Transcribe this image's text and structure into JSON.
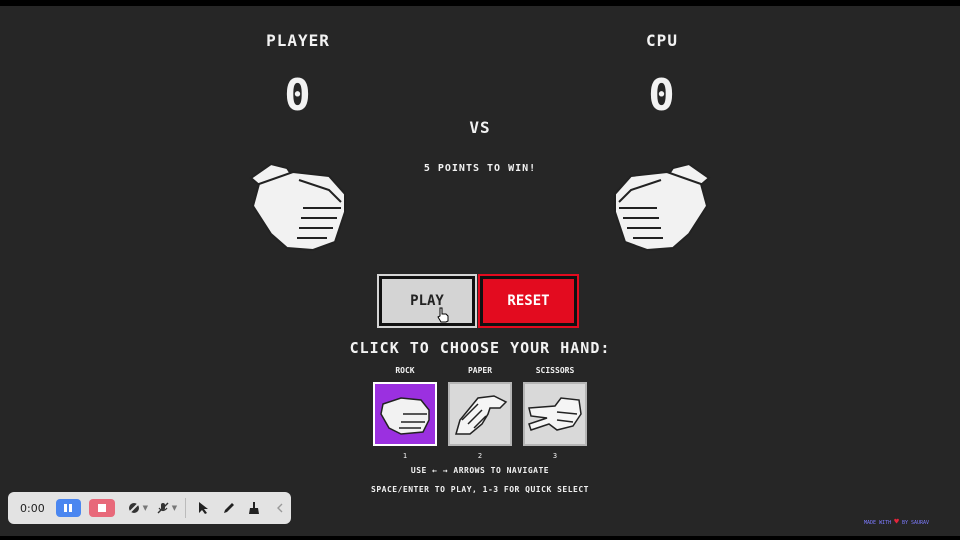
{
  "game": {
    "player_label": "PLAYER",
    "cpu_label": "CPU",
    "player_score": "0",
    "cpu_score": "0",
    "vs_label": "VS",
    "goal_text": "5 POINTS TO WIN!",
    "play_label": "PLAY",
    "reset_label": "RESET",
    "choose_title": "CLICK TO CHOOSE YOUR HAND:",
    "choices": [
      {
        "label": "ROCK",
        "key": "1",
        "icon": "rock-hand-icon",
        "selected": true
      },
      {
        "label": "PAPER",
        "key": "2",
        "icon": "paper-hand-icon",
        "selected": false
      },
      {
        "label": "SCISSORS",
        "key": "3",
        "icon": "scissors-hand-icon",
        "selected": false
      }
    ],
    "hint_arrows": "USE ← → ARROWS TO NAVIGATE",
    "hint_keys": "SPACE/ENTER TO PLAY, 1-3 FOR QUICK SELECT"
  },
  "recorder": {
    "time": "0:00",
    "icons": [
      "pause-icon",
      "stop-icon",
      "camera-off-icon",
      "mic-off-icon",
      "pointer-icon",
      "pen-icon",
      "broom-icon",
      "collapse-icon"
    ]
  },
  "credit": {
    "text_before": "MADE WITH",
    "text_after": "BY SAURAV"
  },
  "colors": {
    "background": "#262626",
    "reset": "#e30b1f",
    "selected": "#9b30e0",
    "pause": "#4a86f0",
    "stop": "#e8697a"
  }
}
